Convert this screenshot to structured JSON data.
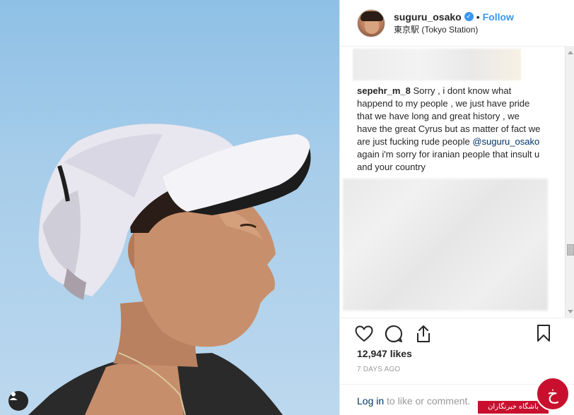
{
  "post": {
    "photo_alt": "",
    "user_tag_icon": "user-icon"
  },
  "header": {
    "username": "suguru_osako",
    "verified_icon": "verified-badge-icon",
    "separator": "•",
    "follow_label": "Follow",
    "location": "東京駅 (Tokyo Station)"
  },
  "comment": {
    "username": "sepehr_m_8",
    "text_part1": " Sorry , i dont know what happend to my people , we just have pride that we have long and great history , we have the great Cyrus but as matter of fact we are just fucking rude people ",
    "mention": "@suguru_osako",
    "text_part2": " again i'm sorry for iranian people that insult u and your country"
  },
  "actions": {
    "like_icon": "heart-icon",
    "comment_icon": "comment-icon",
    "share_icon": "share-icon",
    "save_icon": "bookmark-icon"
  },
  "likes_text": "12,947 likes",
  "time_text": "7 DAYS AGO",
  "login": {
    "link_text": "Log in",
    "rest_text": " to like or comment."
  },
  "watermark": {
    "text": "باشگاه خبرنگاران",
    "glyph": "خ"
  },
  "colors": {
    "accent": "#3897f0",
    "link": "#003569",
    "muted": "#999999",
    "watermark_red": "#c8102e"
  }
}
